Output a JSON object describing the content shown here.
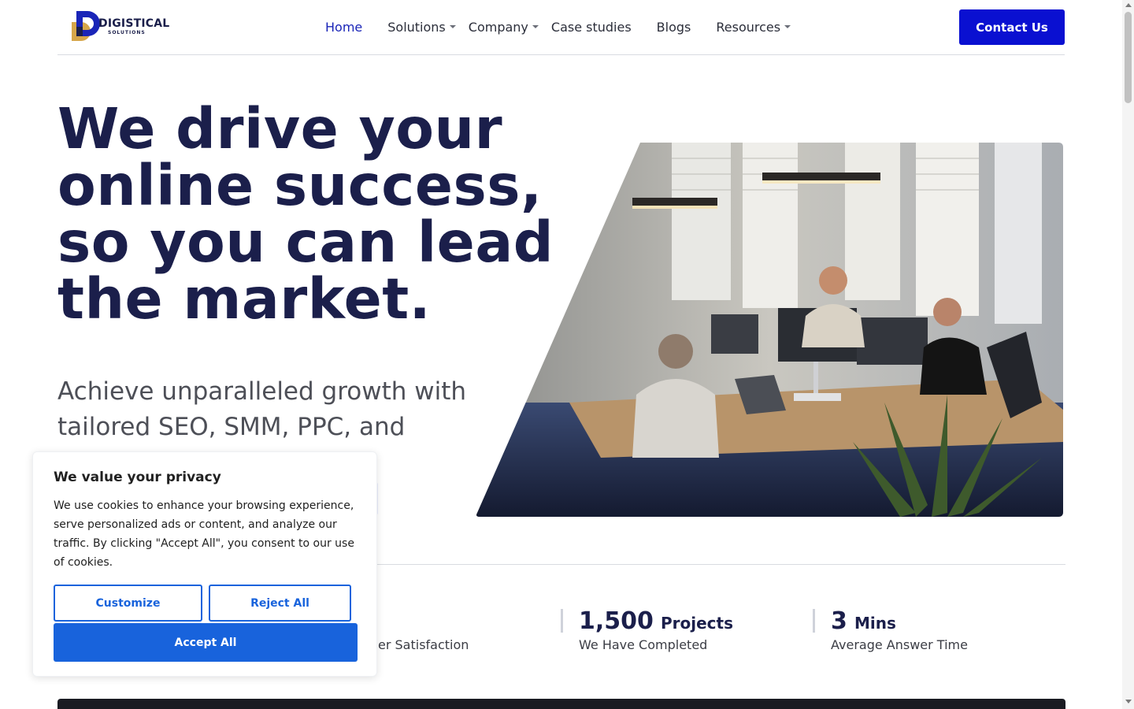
{
  "header": {
    "logo_text": "DIGISTICAL",
    "logo_sub": "SOLUTIONS",
    "nav": [
      {
        "label": "Home",
        "active": true,
        "dropdown": false
      },
      {
        "label": "Solutions",
        "active": false,
        "dropdown": true
      },
      {
        "label": "Company",
        "active": false,
        "dropdown": true
      },
      {
        "label": "Case studies",
        "active": false,
        "dropdown": false
      },
      {
        "label": "Blogs",
        "active": false,
        "dropdown": false
      },
      {
        "label": "Resources",
        "active": false,
        "dropdown": true
      }
    ],
    "contact_label": "Contact Us"
  },
  "hero": {
    "title": "We drive your online success, so you can lead the market.",
    "subtitle": "Achieve unparalleled growth with tailored SEO, SMM, PPC, and"
  },
  "stats": {
    "partial_label": "er Satisfaction",
    "items": [
      {
        "number": "1,500",
        "unit": "Projects",
        "label": "We Have Completed"
      },
      {
        "number": "3",
        "unit": "Mins",
        "label": "Average Answer Time"
      }
    ]
  },
  "cookie": {
    "title": "We value your privacy",
    "text": "We use cookies to enhance your browsing experience, serve personalized ads or content, and analyze our traffic. By clicking \"Accept All\", you consent to our use of cookies.",
    "customize_label": "Customize",
    "reject_label": "Reject All",
    "accept_label": "Accept All"
  },
  "colors": {
    "brand_blue": "#0a10d1",
    "heading_navy": "#1b1f4b",
    "cookie_blue": "#1863dc",
    "logo_gold": "#d6a64a"
  },
  "icons": {
    "logo": "digistical-logo-icon",
    "caret": "chevron-down-icon"
  }
}
